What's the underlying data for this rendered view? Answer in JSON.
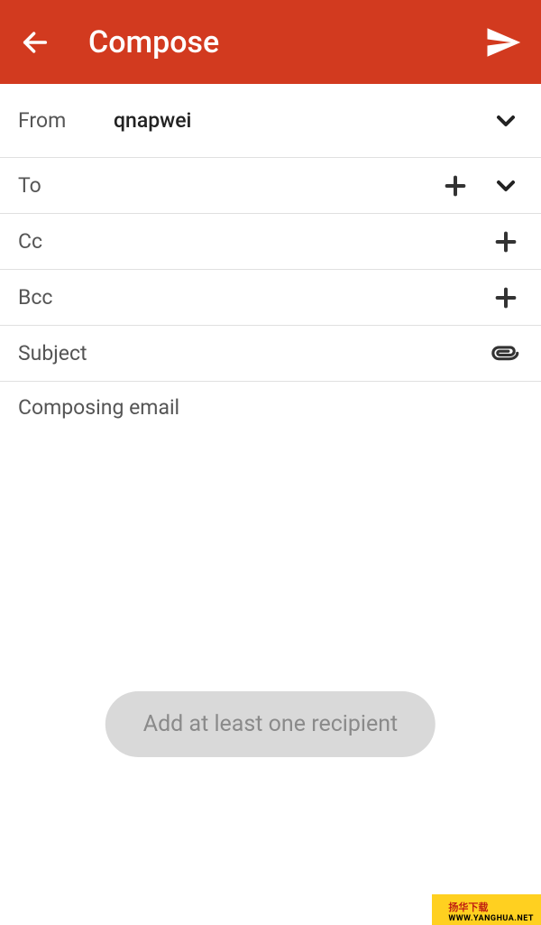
{
  "header": {
    "title": "Compose"
  },
  "from": {
    "label": "From",
    "value": "qnapwei"
  },
  "to": {
    "label": "To"
  },
  "cc": {
    "label": "Cc"
  },
  "bcc": {
    "label": "Bcc"
  },
  "subject": {
    "label": "Subject"
  },
  "body": {
    "placeholder": "Composing email"
  },
  "toast": {
    "message": "Add at least one recipient"
  },
  "watermark": {
    "line1": "扬华下载",
    "line2": "WWW.YANGHUA.NET"
  }
}
